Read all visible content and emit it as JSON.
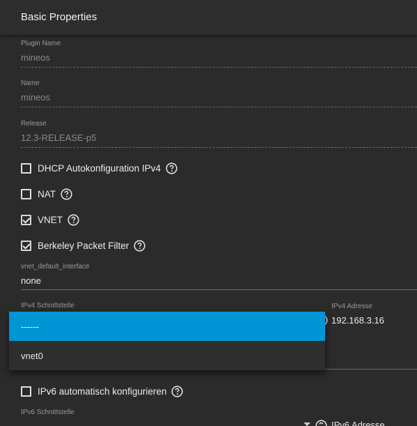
{
  "card": {
    "title": "Basic Properties"
  },
  "fields": {
    "plugin_name": {
      "label": "Plugin Name",
      "value": "mineos"
    },
    "name": {
      "label": "Name",
      "value": "mineos"
    },
    "release": {
      "label": "Release",
      "value": "12.3-RELEASE-p5"
    }
  },
  "checkboxes": {
    "dhcp": {
      "label": "DHCP Autokonfiguration IPv4",
      "checked": false
    },
    "nat": {
      "label": "NAT",
      "checked": false
    },
    "vnet": {
      "label": "VNET",
      "checked": true
    },
    "bpf": {
      "label": "Berkeley Packet Filter",
      "checked": true
    },
    "ipv6_auto": {
      "label": "IPv6 automatisch konfigurieren",
      "checked": false
    }
  },
  "vnet_default_interface": {
    "label": "vnet_default_interface",
    "value": "none"
  },
  "ipv4_interface": {
    "label": "IPv4 Schnittstelle"
  },
  "ipv4_address": {
    "label": "IPv4 Adresse",
    "value": "192.168.3.16"
  },
  "ipv6_interface": {
    "label": "IPv6 Schnittstelle"
  },
  "ipv6_address": {
    "label": "IPv6 Adresse"
  },
  "dropdown": {
    "options": [
      {
        "label": "------",
        "selected": true
      },
      {
        "label": "vnet0",
        "selected": false
      }
    ]
  },
  "colors": {
    "background": "#2b2b2b",
    "accent": "#0095d5",
    "text": "#e6e6e6",
    "muted": "#8a8a8a"
  }
}
